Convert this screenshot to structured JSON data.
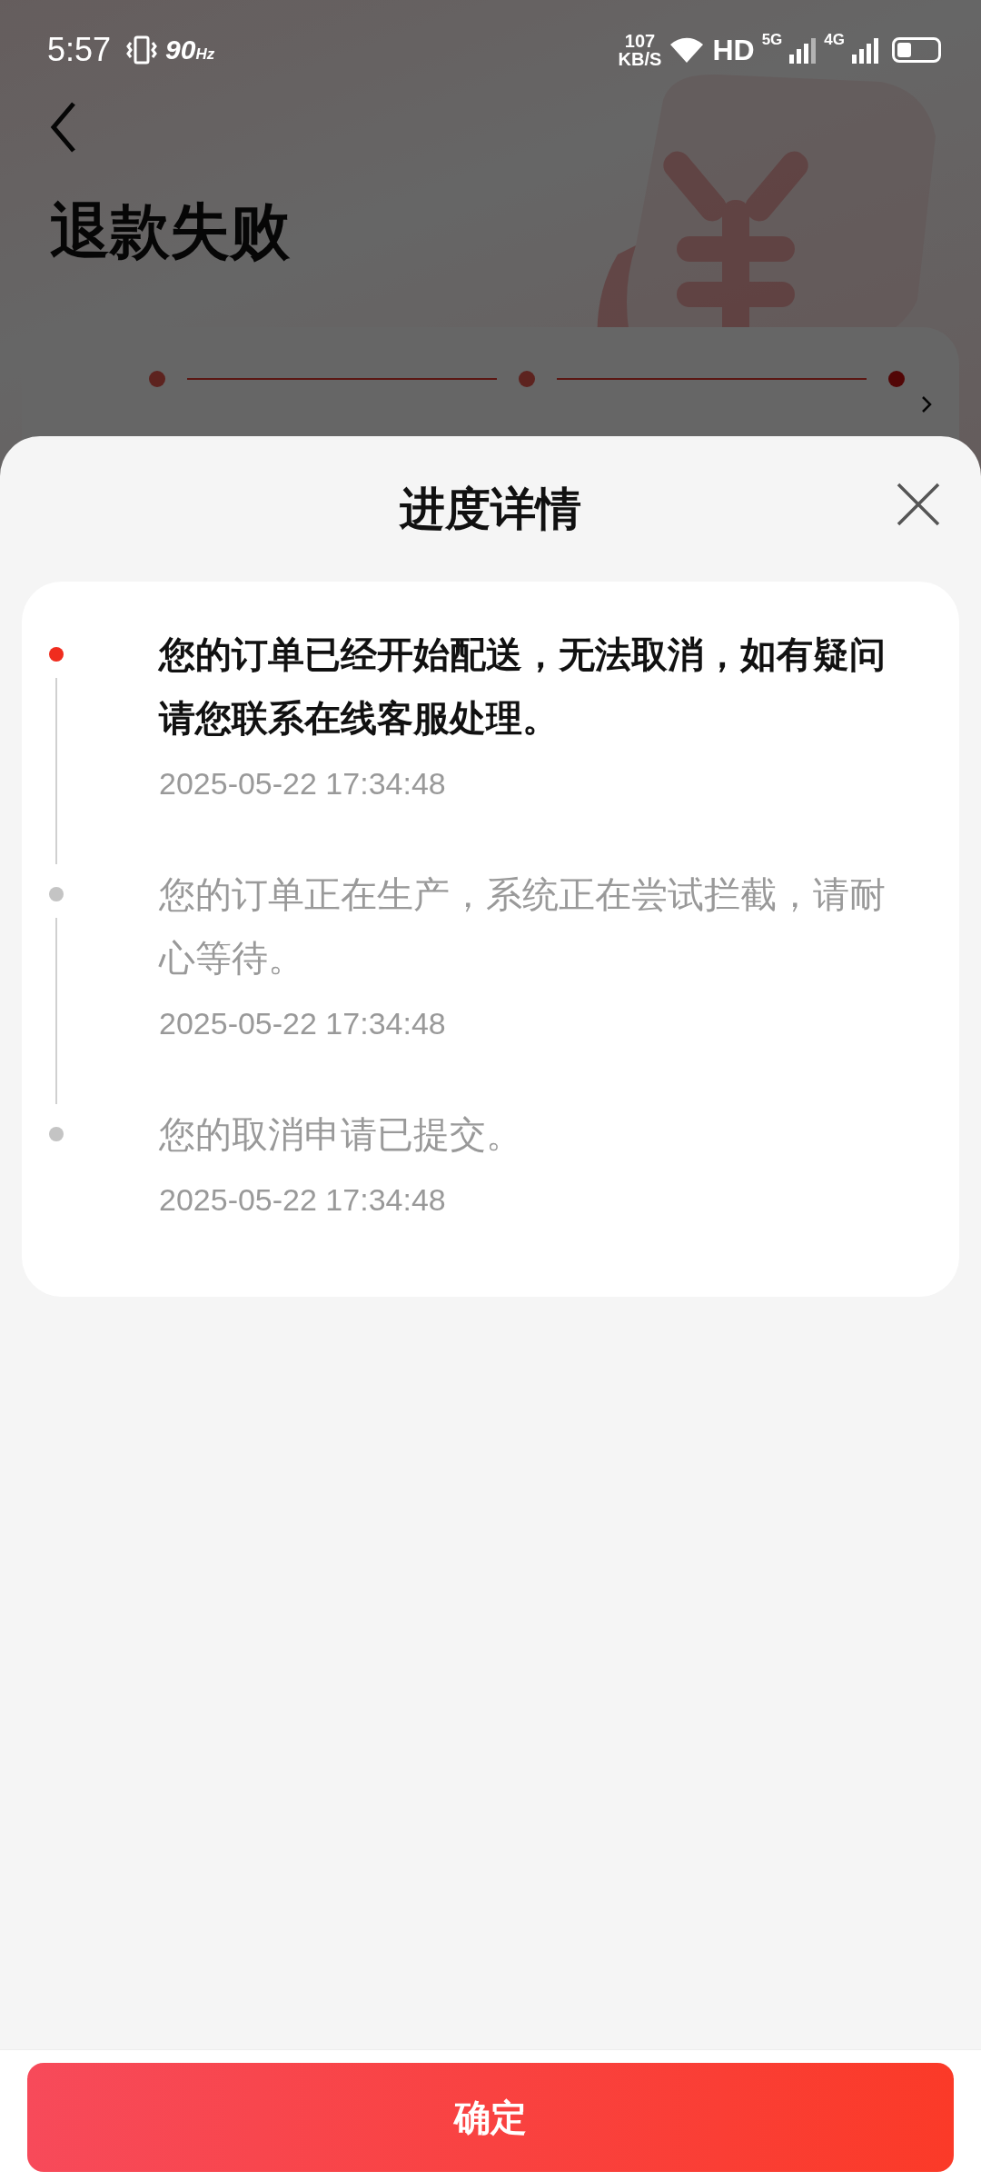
{
  "status_bar": {
    "time": "5:57",
    "refresh_rate": "90",
    "refresh_unit": "Hz",
    "net_speed": "107",
    "net_unit": "KB/S",
    "hd": "HD",
    "signal_1": "5G",
    "signal_2": "4G"
  },
  "header": {
    "title": "退款失败"
  },
  "progress_steps": [
    {
      "current": false
    },
    {
      "current": false
    },
    {
      "current": true
    }
  ],
  "sheet": {
    "title": "进度详情",
    "events": [
      {
        "text": "您的订单已经开始配送，无法取消，如有疑问请您联系在线客服处理。",
        "time": "2025-05-22 17:34:48",
        "active": true
      },
      {
        "text": "您的订单正在生产，系统正在尝试拦截，请耐心等待。",
        "time": "2025-05-22 17:34:48",
        "active": false
      },
      {
        "text": "您的取消申请已提交。",
        "time": "2025-05-22 17:34:48",
        "active": false
      }
    ],
    "confirm_button": "确定"
  }
}
